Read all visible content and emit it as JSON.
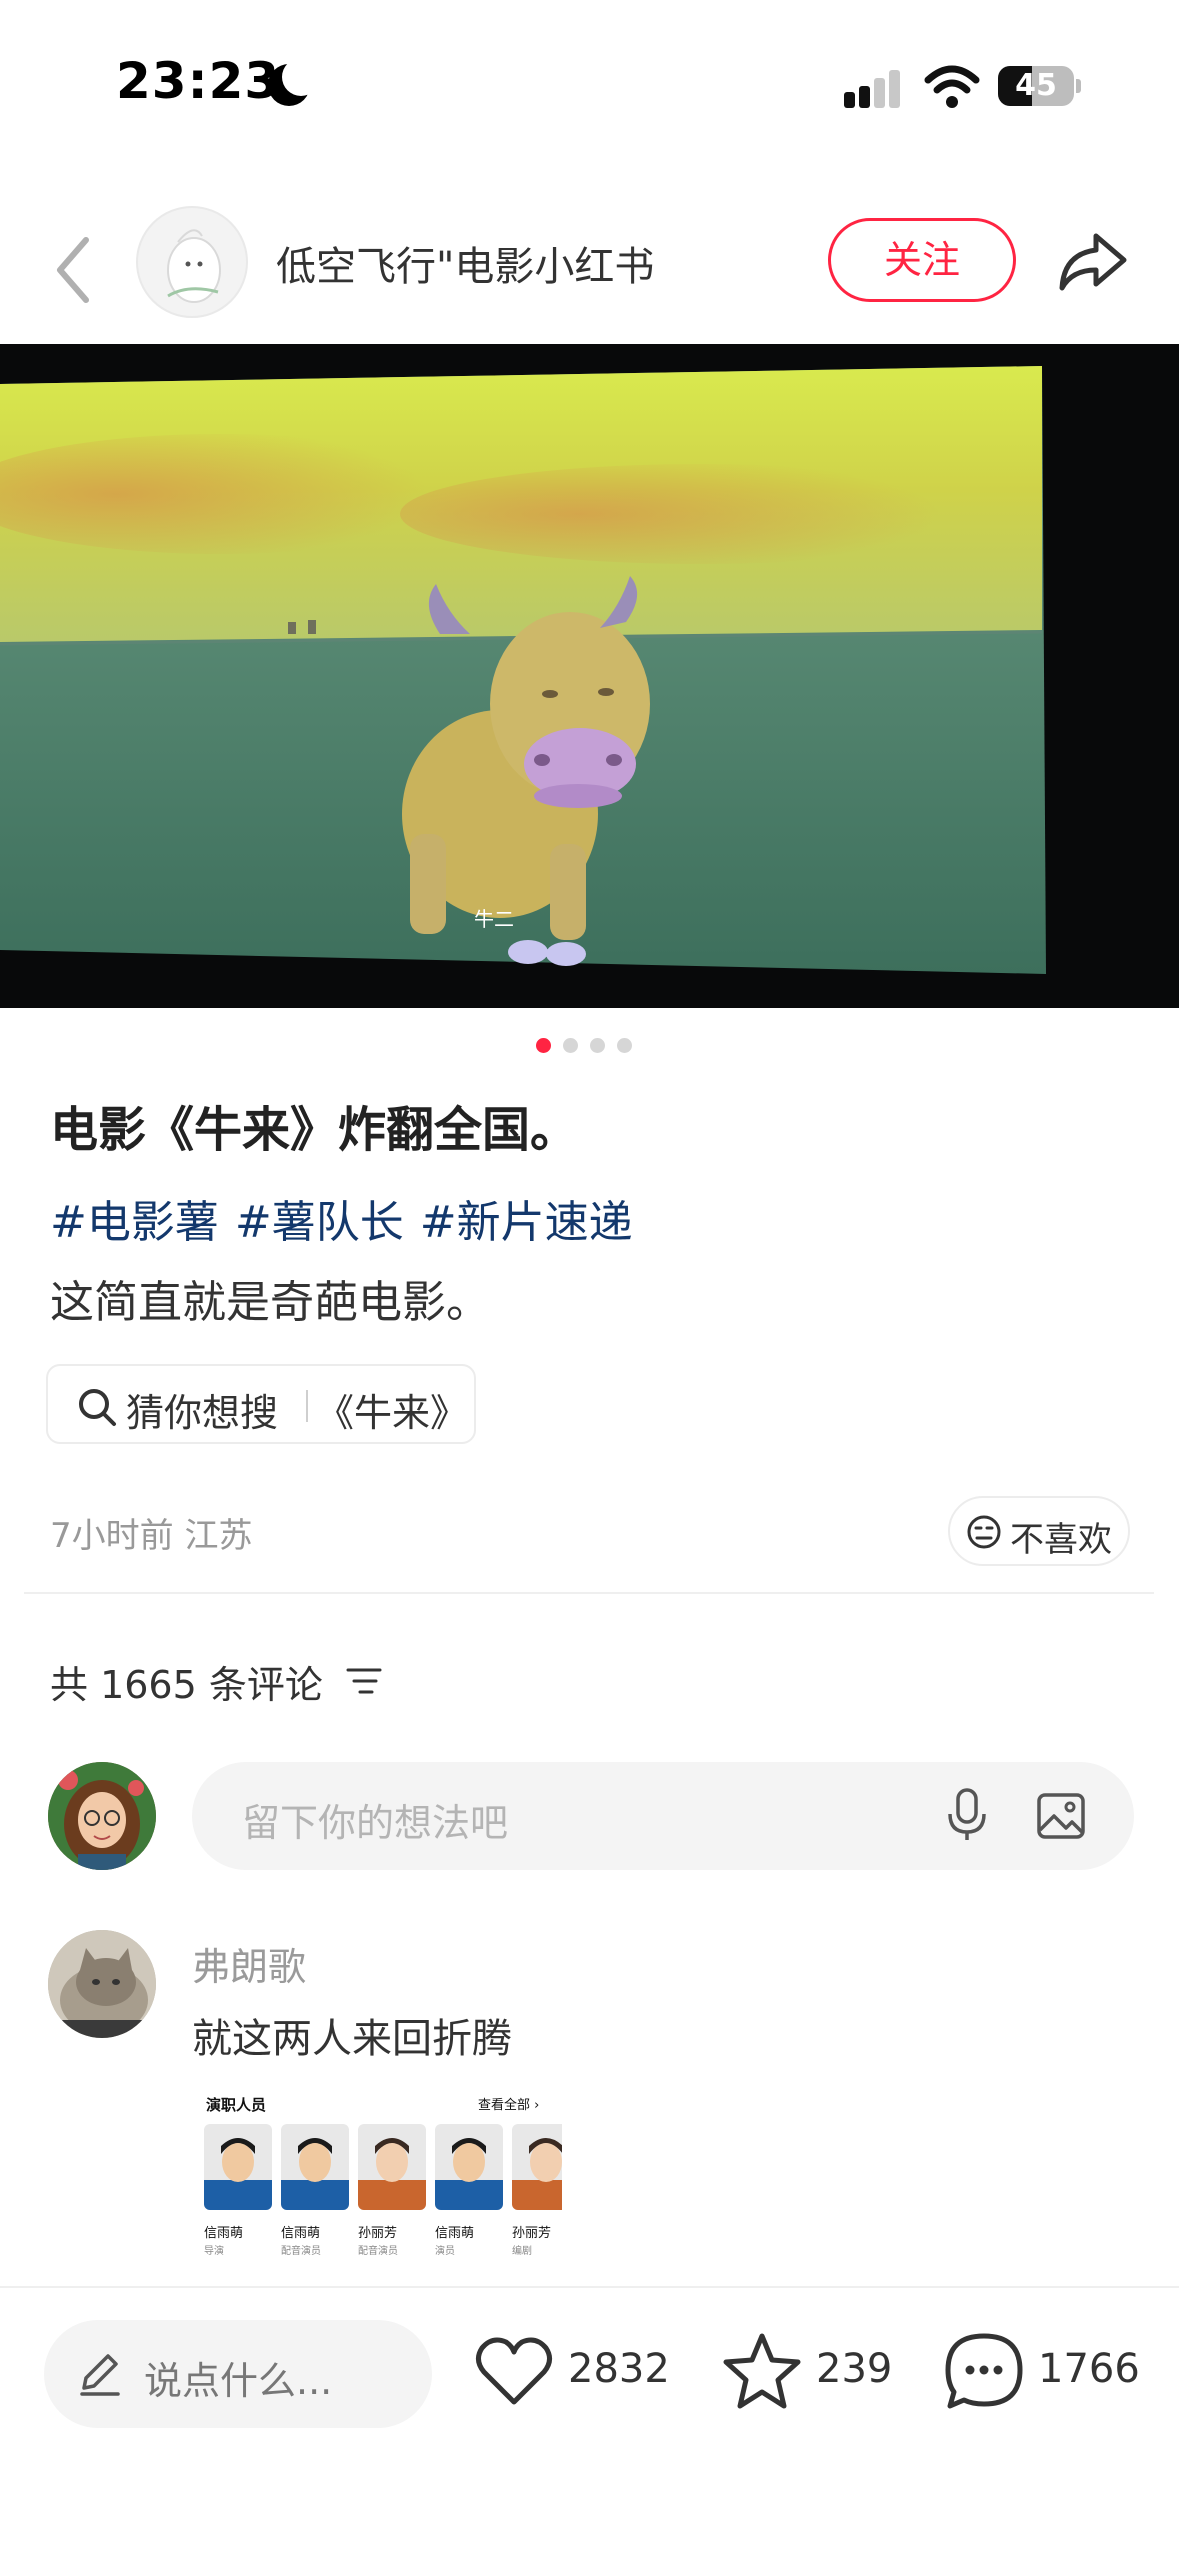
{
  "status_bar": {
    "time": "23:23",
    "battery": "45",
    "battery_level": 0.45,
    "icons": [
      "moon-icon",
      "signal-icon",
      "wifi-icon",
      "battery-icon"
    ]
  },
  "header": {
    "author_name": "低空飞行\"电影小红书",
    "follow_label": "关注",
    "icons": [
      "back-icon",
      "share-icon"
    ]
  },
  "media": {
    "subtitle": "牛二",
    "page_count": 4,
    "active_page": 1
  },
  "post": {
    "title": "电影《牛来》炸翻全国。",
    "hashtags": [
      "#电影薯",
      "#薯队长",
      "#新片速递"
    ],
    "body": "这简直就是奇葩电影。",
    "search_chip": {
      "label": "猜你想搜",
      "query": "《牛来》"
    },
    "meta": "7小时前 江苏",
    "dislike_label": "不喜欢"
  },
  "comments": {
    "count_label": "共 1665 条评论",
    "input_placeholder": "留下你的想法吧",
    "items": [
      {
        "user": "弗朗歌",
        "text": "就这两人来回折腾",
        "image": {
          "title": "演职人员",
          "view_all": "查看全部 ›",
          "cast": [
            {
              "name": "信雨萌",
              "role": "导演"
            },
            {
              "name": "信雨萌",
              "role": "配音演员"
            },
            {
              "name": "孙丽芳",
              "role": "配音演员"
            },
            {
              "name": "信雨萌",
              "role": "演员"
            },
            {
              "name": "孙丽芳",
              "role": "编剧"
            }
          ]
        }
      }
    ]
  },
  "bottom_bar": {
    "input_placeholder": "说点什么...",
    "likes": "2832",
    "stars": "239",
    "comments": "1766"
  },
  "colors": {
    "accent": "#ff2442",
    "hashtag": "#13386c",
    "muted": "#999999"
  }
}
